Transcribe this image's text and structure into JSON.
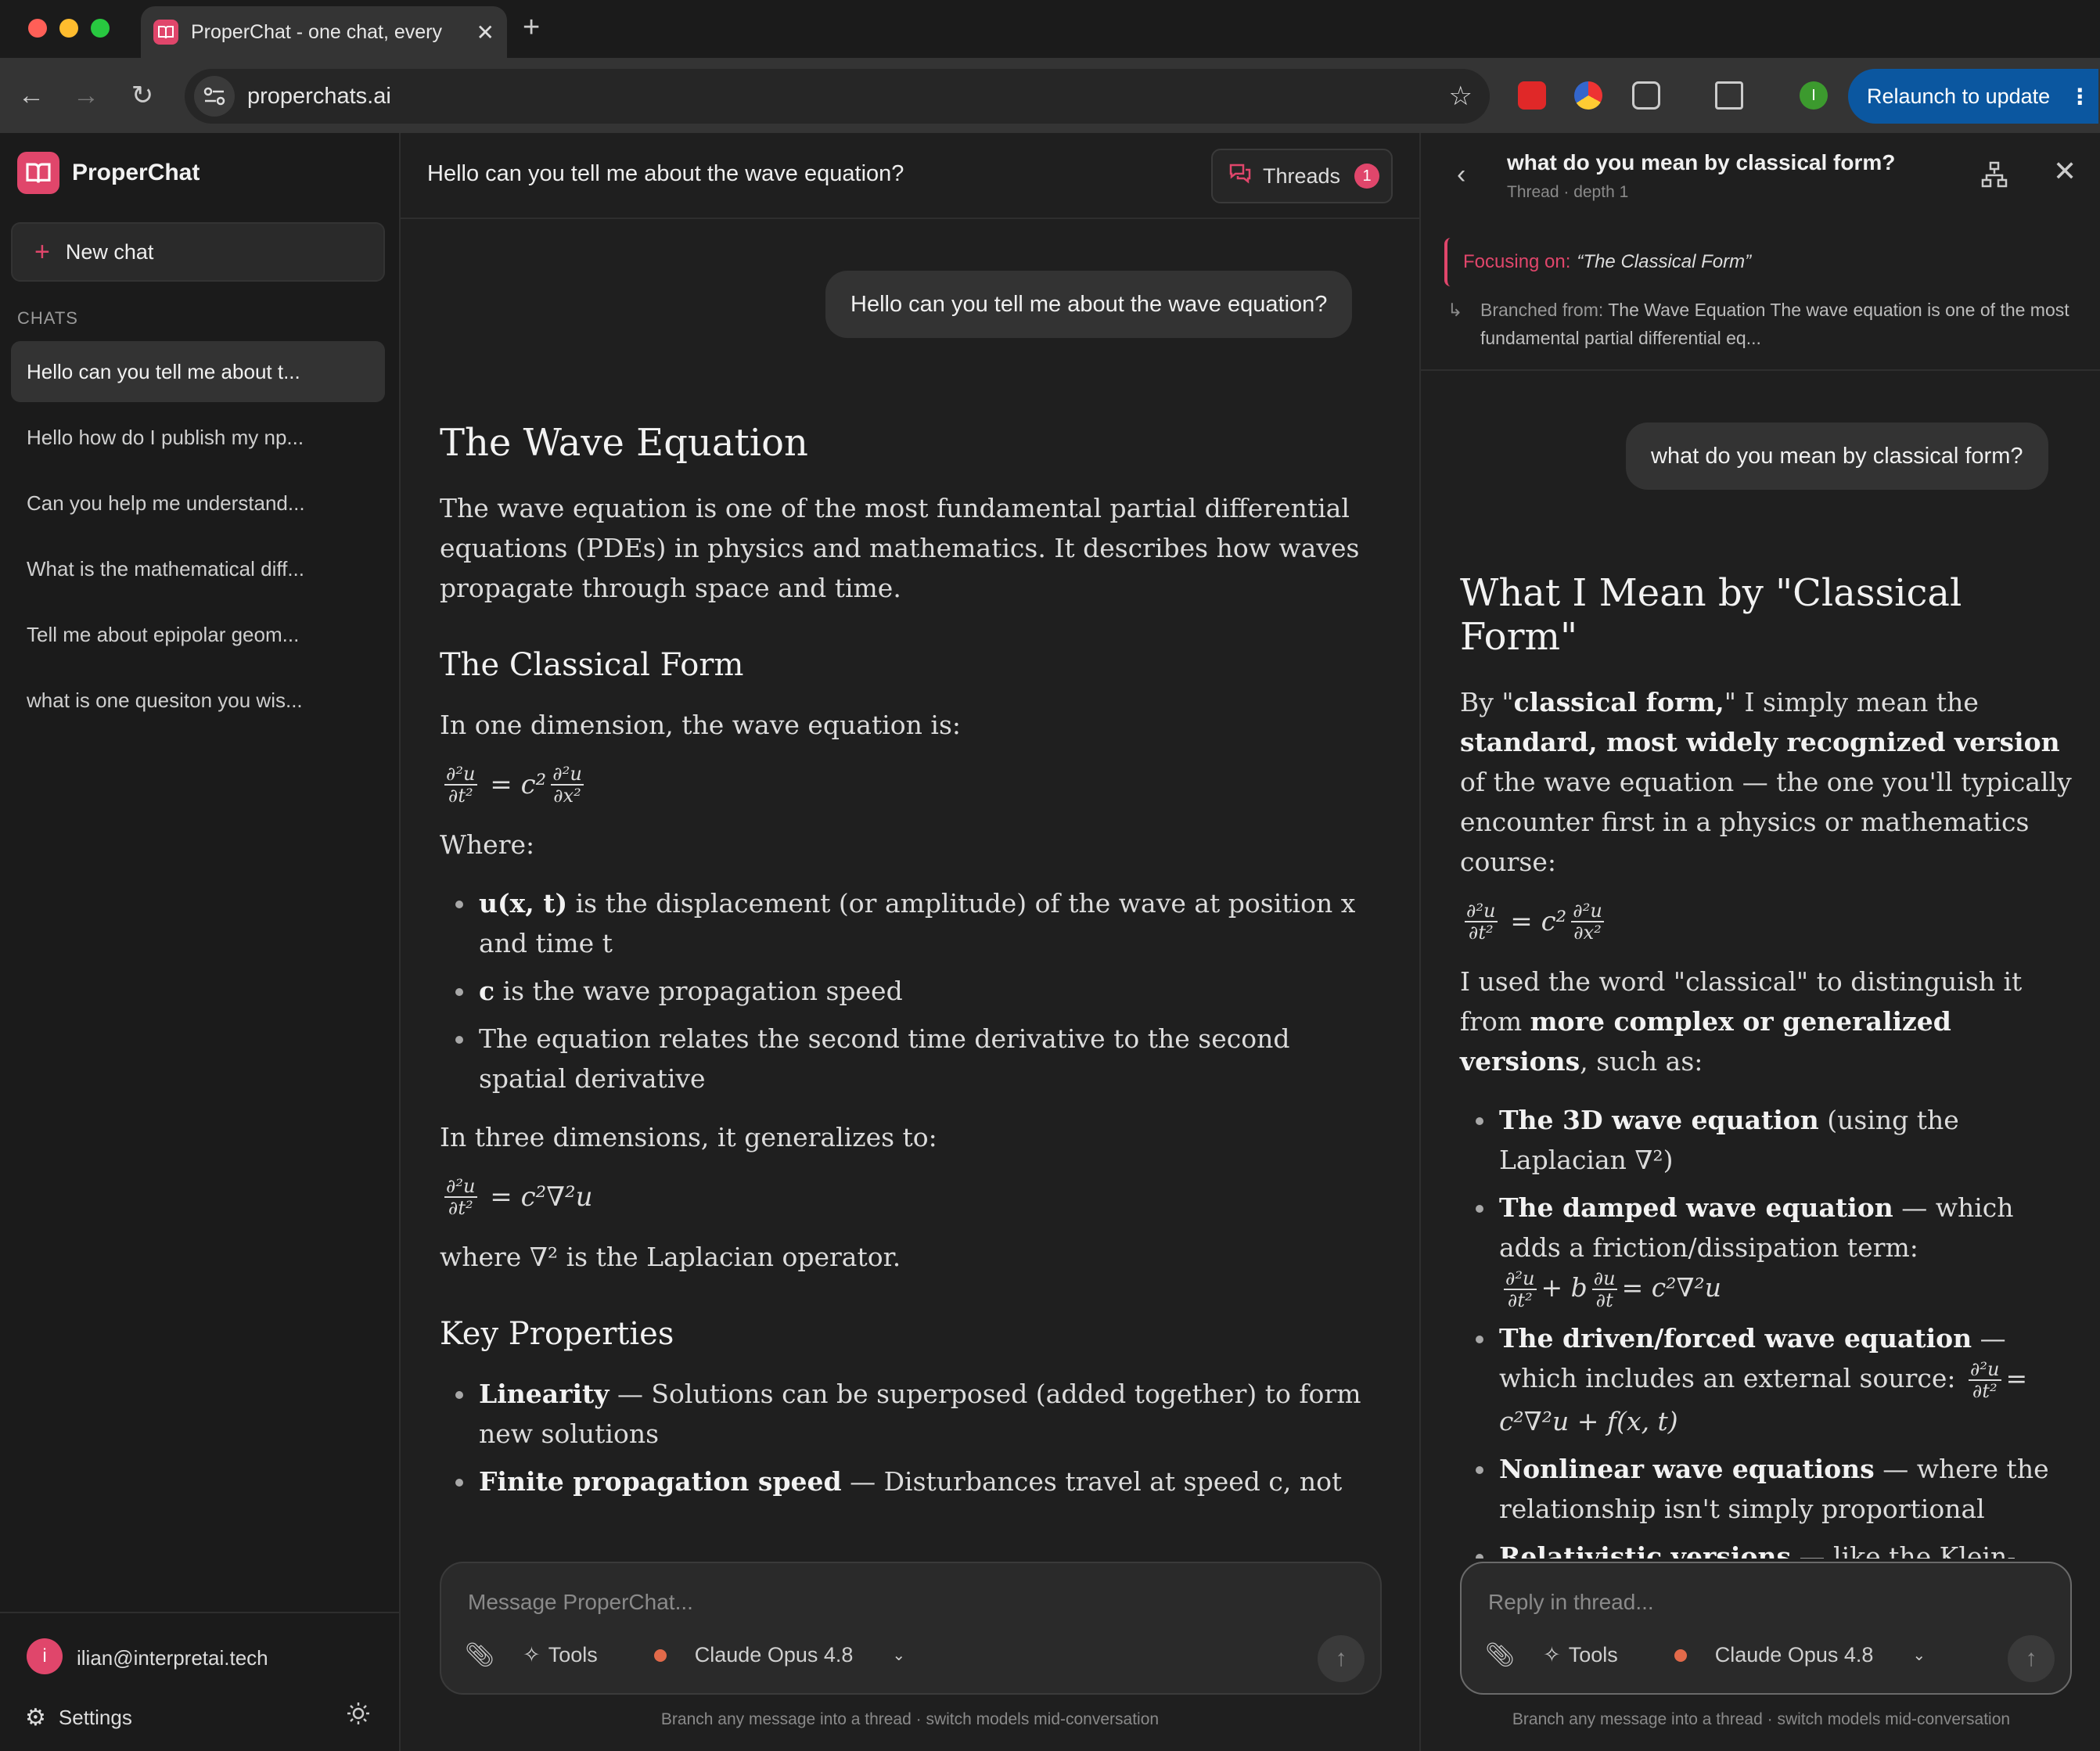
{
  "browser": {
    "tab_title": "ProperChat - one chat, every",
    "url": "properchats.ai",
    "relaunch_label": "Relaunch to update",
    "profile_initial": "I"
  },
  "sidebar": {
    "app_name": "ProperChat",
    "new_chat_label": "New chat",
    "section_label": "CHATS",
    "chats": [
      {
        "label": "Hello can you tell me about t..."
      },
      {
        "label": "Hello how do I publish my np..."
      },
      {
        "label": "Can you help me understand..."
      },
      {
        "label": "What is the mathematical diff..."
      },
      {
        "label": "Tell me about epipolar geom..."
      },
      {
        "label": "what is one quesiton you wis..."
      }
    ],
    "user_initial": "i",
    "user_email": "ilian@interpretai.tech",
    "settings_label": "Settings"
  },
  "main": {
    "header_title": "Hello can you tell me about the wave equation?",
    "threads_label": "Threads",
    "threads_count": "1",
    "user_message": "Hello can you tell me about the wave equation?",
    "h1": "The Wave Equation",
    "intro": "The wave equation is one of the most fundamental partial differential equations (PDEs) in physics and mathematics. It describes how waves propagate through space and time.",
    "h2_classical": "The Classical Form",
    "one_dim": "In one dimension, the wave equation is:",
    "where": "Where:",
    "bullets": [
      {
        "bold": "u(x, t)",
        "text": " is the displacement (or amplitude) of the wave at position x and time t"
      },
      {
        "bold": "c",
        "text": " is the wave propagation speed"
      },
      {
        "bold": "",
        "text": "The equation relates the second time derivative to the second spatial derivative"
      }
    ],
    "three_dim": "In three dimensions, it generalizes to:",
    "laplacian_note": "where ∇² is the Laplacian operator.",
    "h2_key": "Key Properties",
    "key_bullets": [
      {
        "bold": "Linearity",
        "text": " — Solutions can be superposed (added together) to form new solutions"
      },
      {
        "bold": "Finite propagation speed",
        "text": " — Disturbances travel at speed c, not"
      }
    ],
    "composer_placeholder": "Message ProperChat...",
    "tools_label": "Tools",
    "model_label": "Claude Opus 4.8",
    "footnote": "Branch any message into a thread · switch models mid-conversation"
  },
  "thread": {
    "title": "what do you mean by classical form?",
    "subtitle": "Thread · depth 1",
    "focus_label": "Focusing on:",
    "focus_value": "“The Classical Form”",
    "branched_label": "Branched from:",
    "branched_value": "The Wave Equation The wave equation is one of the most fundamental partial differential eq...",
    "user_message": "what do you mean by classical form?",
    "h1": "What I Mean by \"Classical Form\"",
    "p1_a": "By \"",
    "p1_b": "classical form,",
    "p1_c": "\" I simply mean the ",
    "p1_d": "standard, most widely recognized version",
    "p1_e": " of the wave equation — the one you'll typically encounter first in a physics or mathematics course:",
    "p2_a": "I used the word \"classical\" to distinguish it from ",
    "p2_b": "more complex or generalized versions",
    "p2_c": ", such as:",
    "bullets": [
      {
        "bold": "The 3D wave equation",
        "text": " (using the Laplacian ∇²)"
      },
      {
        "bold": "The damped wave equation",
        "text": " — which adds a friction/dissipation term:"
      },
      {
        "bold": "The driven/forced wave equation",
        "text": " — which includes an external source:"
      },
      {
        "bold": "Nonlinear wave equations",
        "text": " — where the relationship isn't simply proportional"
      },
      {
        "bold": "Relativistic versions",
        "text": " — like the Klein-Gordon equation"
      }
    ],
    "composer_placeholder": "Reply in thread...",
    "tools_label": "Tools",
    "model_label": "Claude Opus 4.8",
    "footnote": "Branch any message into a thread · switch models mid-conversation"
  },
  "colors": {
    "accent": "#e0466b",
    "relaunch": "#0b57a0",
    "bg": "#1f1f1f"
  }
}
